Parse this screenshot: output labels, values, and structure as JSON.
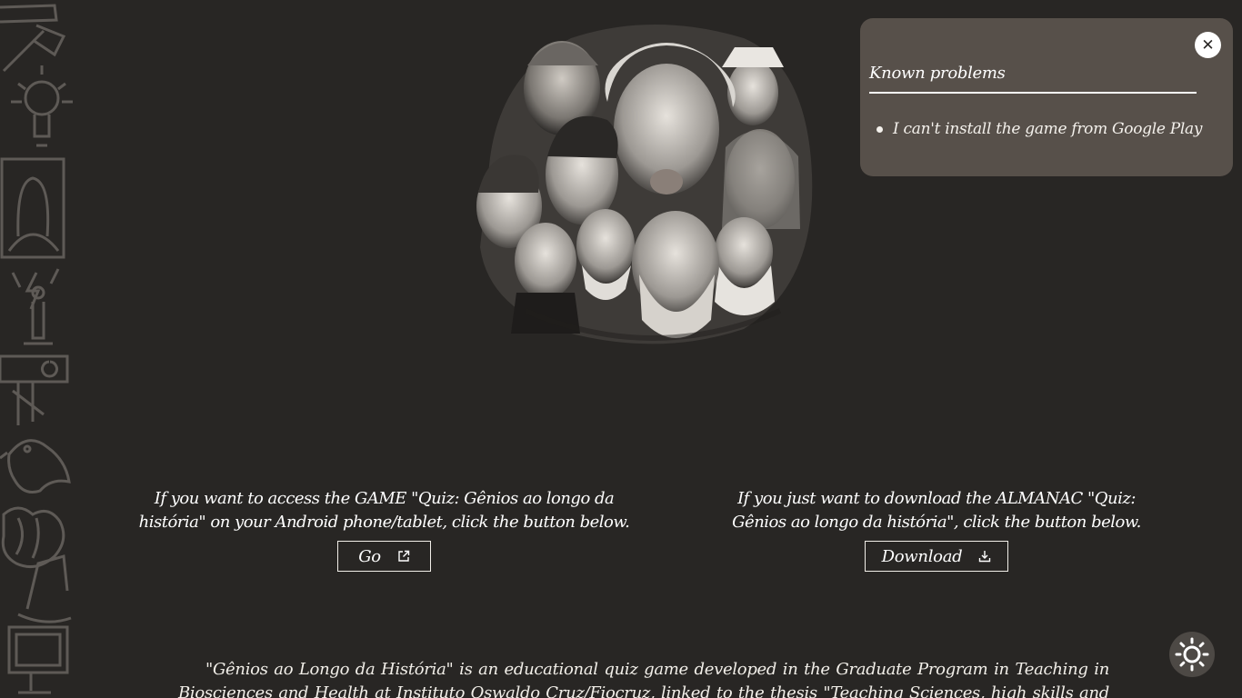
{
  "known_problems": {
    "title": "Known problems",
    "close_label": "✕",
    "items": [
      {
        "text": "I can't install the game from Google Play"
      }
    ]
  },
  "game_section": {
    "text": "If you want to access the GAME \"Quiz: Gênios ao longo da história\" on your Android phone/tablet, click the button below.",
    "button_label": "Go",
    "button_icon": "external-link-icon"
  },
  "almanac_section": {
    "text": "If you just want to download the ALMANAC \"Quiz: Gênios ao longo da história\", click the button below.",
    "button_label": "Download",
    "button_icon": "download-icon"
  },
  "description": {
    "text": "\"Gênios ao Longo da História\" is an educational quiz game developed in the Graduate Program in Teaching in Biosciences and Health at Instituto Oswaldo Cruz/Fiocruz, linked to the thesis \"Teaching Sciences, high skills and scientific vocation: youth"
  },
  "theme_toggle": {
    "icon": "sun-icon"
  },
  "colors": {
    "background": "#282624",
    "panel": "#57504a",
    "text": "#f2efe9",
    "toggle": "#4d4945"
  }
}
